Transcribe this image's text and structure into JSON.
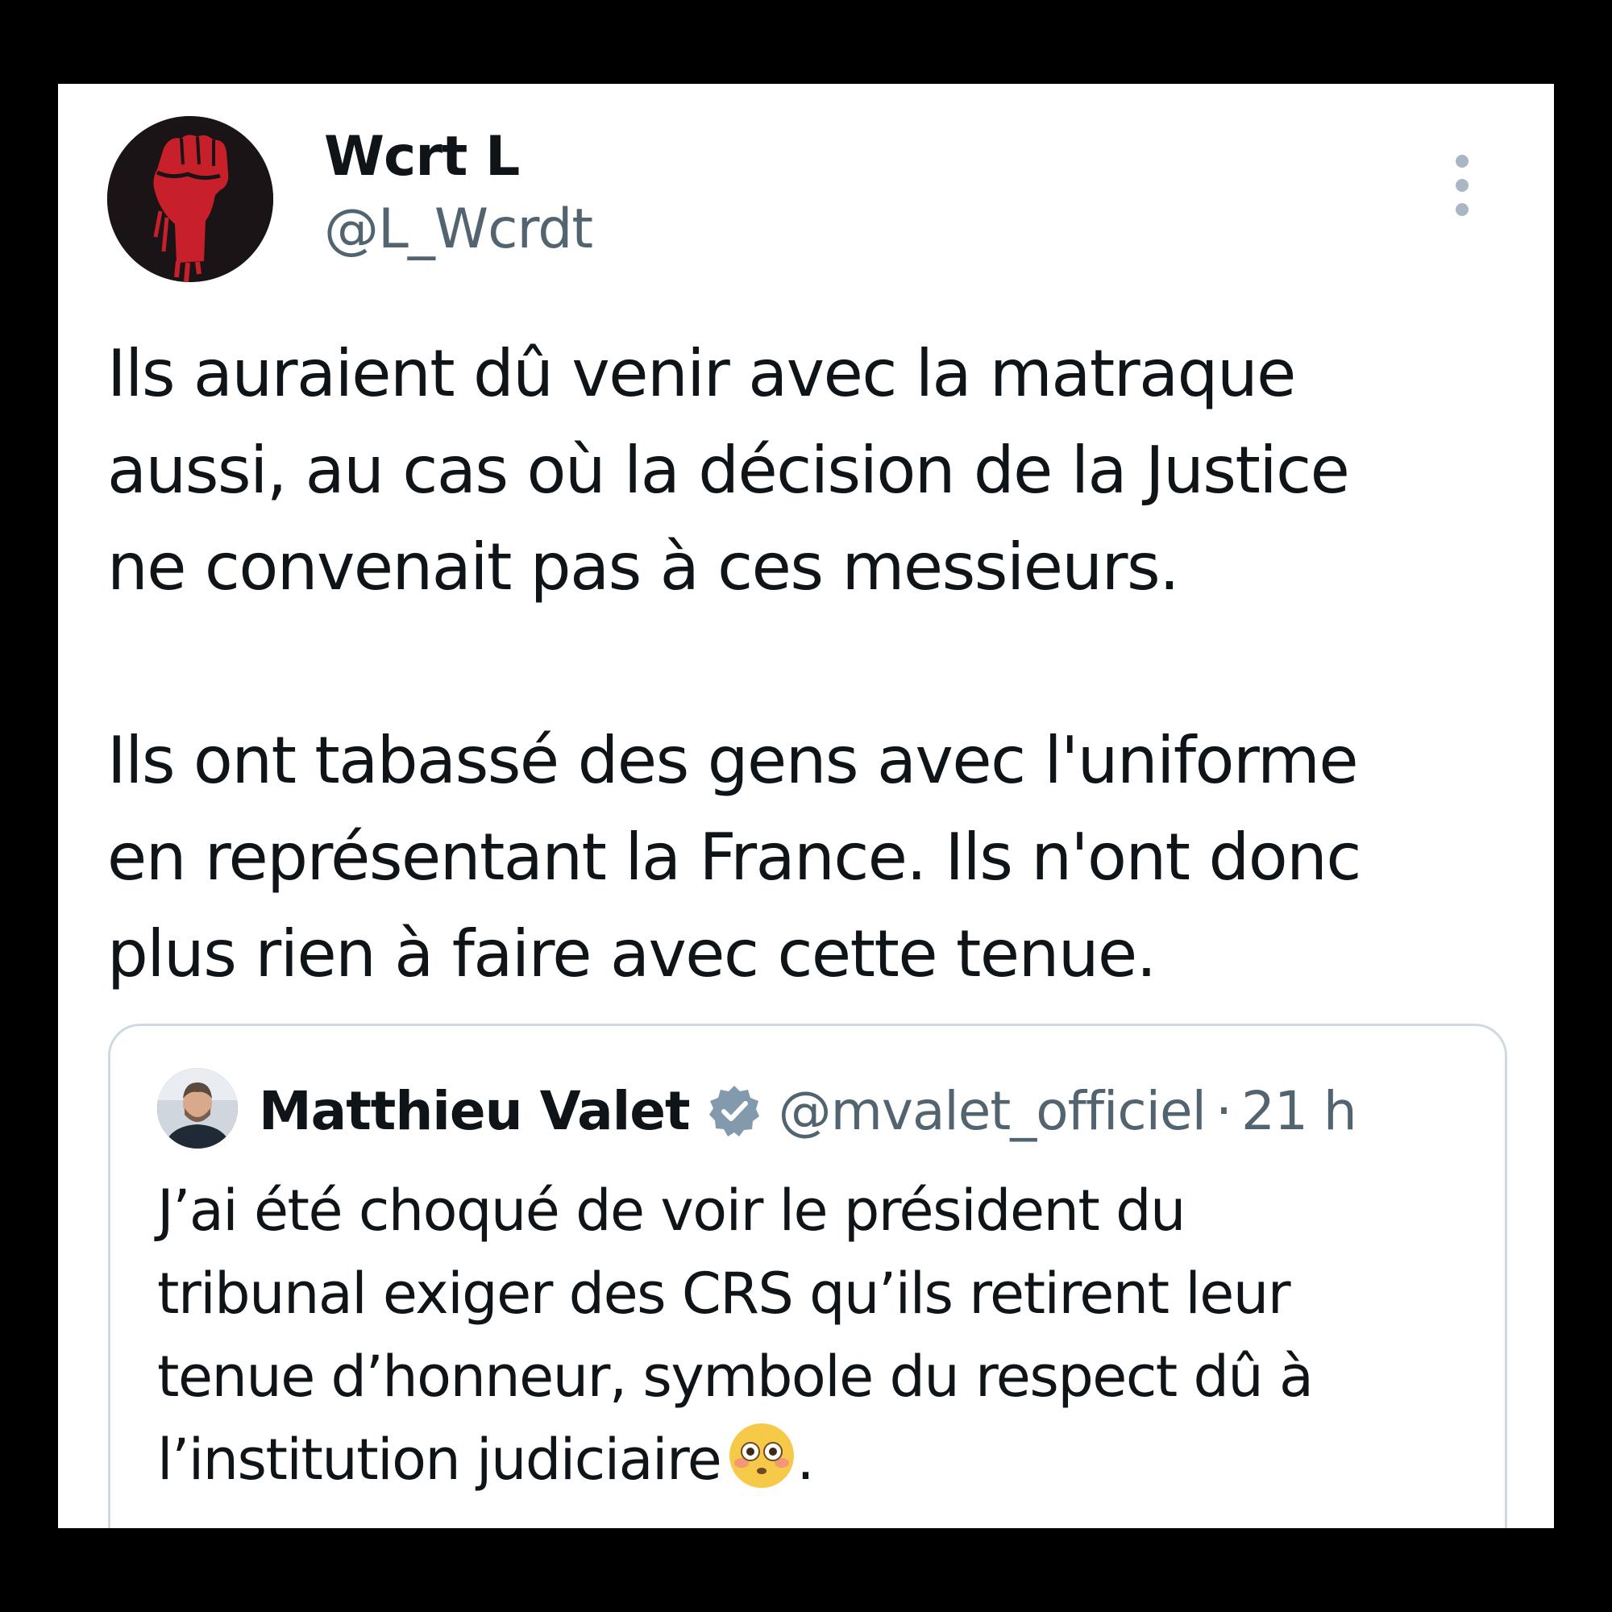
{
  "tweet": {
    "author_name": "Wcrt L",
    "author_handle": "@L_Wcrdt",
    "paragraphs": [
      [
        "Ils auraient dû venir avec la matraque",
        "aussi, au cas où la décision de la Justice",
        "ne convenait pas à ces messieurs."
      ],
      [
        "Ils ont tabassé des gens avec l'uniforme",
        "en représentant la France. Ils n'ont donc",
        "plus rien à faire avec cette tenue."
      ]
    ]
  },
  "quoted_tweet": {
    "author_name": "Matthieu Valet",
    "verified": true,
    "author_handle": "@mvalet_officiel",
    "separator": "·",
    "time": "21 h",
    "lines": [
      "J’ai été choqué de voir le président du",
      "tribunal exiger des CRS qu’ils retirent leur",
      "tenue d’honneur, symbole du respect dû à",
      "l’institution judiciaire"
    ],
    "trailing_emoji": "flushed-face",
    "trailing_text": "."
  },
  "colors": {
    "background": "#000000",
    "card": "#ffffff",
    "text_primary": "#0f1419",
    "text_secondary": "#536471",
    "border": "#cfd9de",
    "fist_red": "#c8202a"
  },
  "icons": {
    "more": "more-vertical-icon",
    "verified": "verified-badge-icon",
    "avatar": "raised-fist-avatar"
  }
}
